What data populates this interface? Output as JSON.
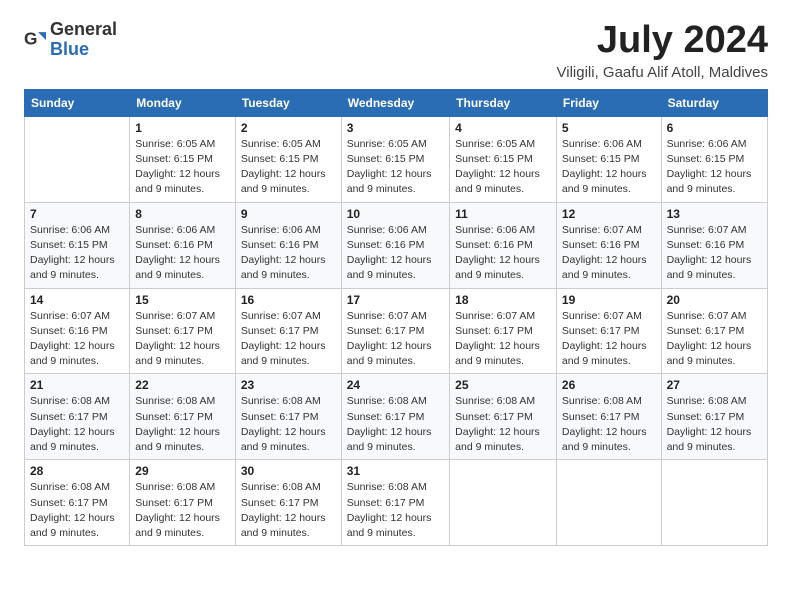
{
  "header": {
    "logo_general": "General",
    "logo_blue": "Blue",
    "month": "July 2024",
    "location": "Viligili, Gaafu Alif Atoll, Maldives"
  },
  "weekdays": [
    "Sunday",
    "Monday",
    "Tuesday",
    "Wednesday",
    "Thursday",
    "Friday",
    "Saturday"
  ],
  "weeks": [
    [
      {
        "day": "",
        "sunrise": "",
        "sunset": "",
        "daylight": ""
      },
      {
        "day": "1",
        "sunrise": "Sunrise: 6:05 AM",
        "sunset": "Sunset: 6:15 PM",
        "daylight": "Daylight: 12 hours and 9 minutes."
      },
      {
        "day": "2",
        "sunrise": "Sunrise: 6:05 AM",
        "sunset": "Sunset: 6:15 PM",
        "daylight": "Daylight: 12 hours and 9 minutes."
      },
      {
        "day": "3",
        "sunrise": "Sunrise: 6:05 AM",
        "sunset": "Sunset: 6:15 PM",
        "daylight": "Daylight: 12 hours and 9 minutes."
      },
      {
        "day": "4",
        "sunrise": "Sunrise: 6:05 AM",
        "sunset": "Sunset: 6:15 PM",
        "daylight": "Daylight: 12 hours and 9 minutes."
      },
      {
        "day": "5",
        "sunrise": "Sunrise: 6:06 AM",
        "sunset": "Sunset: 6:15 PM",
        "daylight": "Daylight: 12 hours and 9 minutes."
      },
      {
        "day": "6",
        "sunrise": "Sunrise: 6:06 AM",
        "sunset": "Sunset: 6:15 PM",
        "daylight": "Daylight: 12 hours and 9 minutes."
      }
    ],
    [
      {
        "day": "7",
        "sunrise": "Sunrise: 6:06 AM",
        "sunset": "Sunset: 6:15 PM",
        "daylight": "Daylight: 12 hours and 9 minutes."
      },
      {
        "day": "8",
        "sunrise": "Sunrise: 6:06 AM",
        "sunset": "Sunset: 6:16 PM",
        "daylight": "Daylight: 12 hours and 9 minutes."
      },
      {
        "day": "9",
        "sunrise": "Sunrise: 6:06 AM",
        "sunset": "Sunset: 6:16 PM",
        "daylight": "Daylight: 12 hours and 9 minutes."
      },
      {
        "day": "10",
        "sunrise": "Sunrise: 6:06 AM",
        "sunset": "Sunset: 6:16 PM",
        "daylight": "Daylight: 12 hours and 9 minutes."
      },
      {
        "day": "11",
        "sunrise": "Sunrise: 6:06 AM",
        "sunset": "Sunset: 6:16 PM",
        "daylight": "Daylight: 12 hours and 9 minutes."
      },
      {
        "day": "12",
        "sunrise": "Sunrise: 6:07 AM",
        "sunset": "Sunset: 6:16 PM",
        "daylight": "Daylight: 12 hours and 9 minutes."
      },
      {
        "day": "13",
        "sunrise": "Sunrise: 6:07 AM",
        "sunset": "Sunset: 6:16 PM",
        "daylight": "Daylight: 12 hours and 9 minutes."
      }
    ],
    [
      {
        "day": "14",
        "sunrise": "Sunrise: 6:07 AM",
        "sunset": "Sunset: 6:16 PM",
        "daylight": "Daylight: 12 hours and 9 minutes."
      },
      {
        "day": "15",
        "sunrise": "Sunrise: 6:07 AM",
        "sunset": "Sunset: 6:17 PM",
        "daylight": "Daylight: 12 hours and 9 minutes."
      },
      {
        "day": "16",
        "sunrise": "Sunrise: 6:07 AM",
        "sunset": "Sunset: 6:17 PM",
        "daylight": "Daylight: 12 hours and 9 minutes."
      },
      {
        "day": "17",
        "sunrise": "Sunrise: 6:07 AM",
        "sunset": "Sunset: 6:17 PM",
        "daylight": "Daylight: 12 hours and 9 minutes."
      },
      {
        "day": "18",
        "sunrise": "Sunrise: 6:07 AM",
        "sunset": "Sunset: 6:17 PM",
        "daylight": "Daylight: 12 hours and 9 minutes."
      },
      {
        "day": "19",
        "sunrise": "Sunrise: 6:07 AM",
        "sunset": "Sunset: 6:17 PM",
        "daylight": "Daylight: 12 hours and 9 minutes."
      },
      {
        "day": "20",
        "sunrise": "Sunrise: 6:07 AM",
        "sunset": "Sunset: 6:17 PM",
        "daylight": "Daylight: 12 hours and 9 minutes."
      }
    ],
    [
      {
        "day": "21",
        "sunrise": "Sunrise: 6:08 AM",
        "sunset": "Sunset: 6:17 PM",
        "daylight": "Daylight: 12 hours and 9 minutes."
      },
      {
        "day": "22",
        "sunrise": "Sunrise: 6:08 AM",
        "sunset": "Sunset: 6:17 PM",
        "daylight": "Daylight: 12 hours and 9 minutes."
      },
      {
        "day": "23",
        "sunrise": "Sunrise: 6:08 AM",
        "sunset": "Sunset: 6:17 PM",
        "daylight": "Daylight: 12 hours and 9 minutes."
      },
      {
        "day": "24",
        "sunrise": "Sunrise: 6:08 AM",
        "sunset": "Sunset: 6:17 PM",
        "daylight": "Daylight: 12 hours and 9 minutes."
      },
      {
        "day": "25",
        "sunrise": "Sunrise: 6:08 AM",
        "sunset": "Sunset: 6:17 PM",
        "daylight": "Daylight: 12 hours and 9 minutes."
      },
      {
        "day": "26",
        "sunrise": "Sunrise: 6:08 AM",
        "sunset": "Sunset: 6:17 PM",
        "daylight": "Daylight: 12 hours and 9 minutes."
      },
      {
        "day": "27",
        "sunrise": "Sunrise: 6:08 AM",
        "sunset": "Sunset: 6:17 PM",
        "daylight": "Daylight: 12 hours and 9 minutes."
      }
    ],
    [
      {
        "day": "28",
        "sunrise": "Sunrise: 6:08 AM",
        "sunset": "Sunset: 6:17 PM",
        "daylight": "Daylight: 12 hours and 9 minutes."
      },
      {
        "day": "29",
        "sunrise": "Sunrise: 6:08 AM",
        "sunset": "Sunset: 6:17 PM",
        "daylight": "Daylight: 12 hours and 9 minutes."
      },
      {
        "day": "30",
        "sunrise": "Sunrise: 6:08 AM",
        "sunset": "Sunset: 6:17 PM",
        "daylight": "Daylight: 12 hours and 9 minutes."
      },
      {
        "day": "31",
        "sunrise": "Sunrise: 6:08 AM",
        "sunset": "Sunset: 6:17 PM",
        "daylight": "Daylight: 12 hours and 9 minutes."
      },
      {
        "day": "",
        "sunrise": "",
        "sunset": "",
        "daylight": ""
      },
      {
        "day": "",
        "sunrise": "",
        "sunset": "",
        "daylight": ""
      },
      {
        "day": "",
        "sunrise": "",
        "sunset": "",
        "daylight": ""
      }
    ]
  ]
}
